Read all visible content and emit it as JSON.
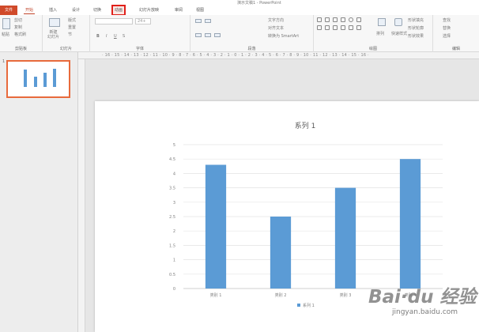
{
  "window": {
    "title": "演示文稿1 - PowerPoint"
  },
  "tabs": [
    {
      "label": "文件"
    },
    {
      "label": "开始"
    },
    {
      "label": "插入"
    },
    {
      "label": "设计"
    },
    {
      "label": "切换"
    },
    {
      "label": "动画"
    },
    {
      "label": "幻灯片放映"
    },
    {
      "label": "审阅"
    },
    {
      "label": "视图"
    }
  ],
  "ribbon": {
    "groups": [
      {
        "label": "剪贴板"
      },
      {
        "label": "幻灯片"
      },
      {
        "label": "字体"
      },
      {
        "label": "段落"
      },
      {
        "label": "绘图"
      },
      {
        "label": "编辑"
      }
    ],
    "clipboard": {
      "paste": "粘贴",
      "cut": "剪切",
      "copy": "复制",
      "format_painter": "格式刷"
    },
    "slides": {
      "new_slide": "新建\n幻灯片",
      "layout": "版式",
      "reset": "重置",
      "section": "节"
    },
    "font": {
      "size": "24+"
    },
    "paragraph": {
      "text_direction": "文字方向",
      "align_text": "对齐文本",
      "smartart": "转换为 SmartArt"
    },
    "drawing": {
      "arrange": "排列",
      "quick_styles": "快速样式",
      "shape_fill": "形状填充",
      "shape_outline": "形状轮廓",
      "shape_effects": "形状效果"
    },
    "editing": {
      "find": "查找",
      "replace": "替换",
      "select": "选择"
    }
  },
  "ruler": {
    "ticks": "· 16 · 15 · 14 · 13 · 12 · 11 · 10 · 9 · 8 · 7 · 6 · 5 · 4 · 3 · 2 · 1 · 0 · 1 · 2 · 3 · 4 · 5 · 6 · 7 · 8 · 9 · 10 · 11 · 12 · 13 · 14 · 15 · 16 ·"
  },
  "slide_panel": {
    "slide_number": "1"
  },
  "watermark": {
    "logo": "Bai·du 经验",
    "url": "jingyan.baidu.com"
  },
  "colors": {
    "accent": "#d04a2a",
    "bar": "#5b9bd5",
    "highlight": "#e0201a"
  },
  "chart_data": {
    "type": "bar",
    "title": "系列 1",
    "categories": [
      "类别 1",
      "类别 2",
      "类别 3",
      "类别 4"
    ],
    "series": [
      {
        "name": "系列 1",
        "values": [
          4.3,
          2.5,
          3.5,
          4.5
        ]
      }
    ],
    "ylim": [
      0,
      5
    ],
    "yticks": [
      "0",
      "0.5",
      "1",
      "1.5",
      "2",
      "2.5",
      "3",
      "3.5",
      "4",
      "4.5",
      "5"
    ],
    "grid": true,
    "legend": "bottom"
  }
}
